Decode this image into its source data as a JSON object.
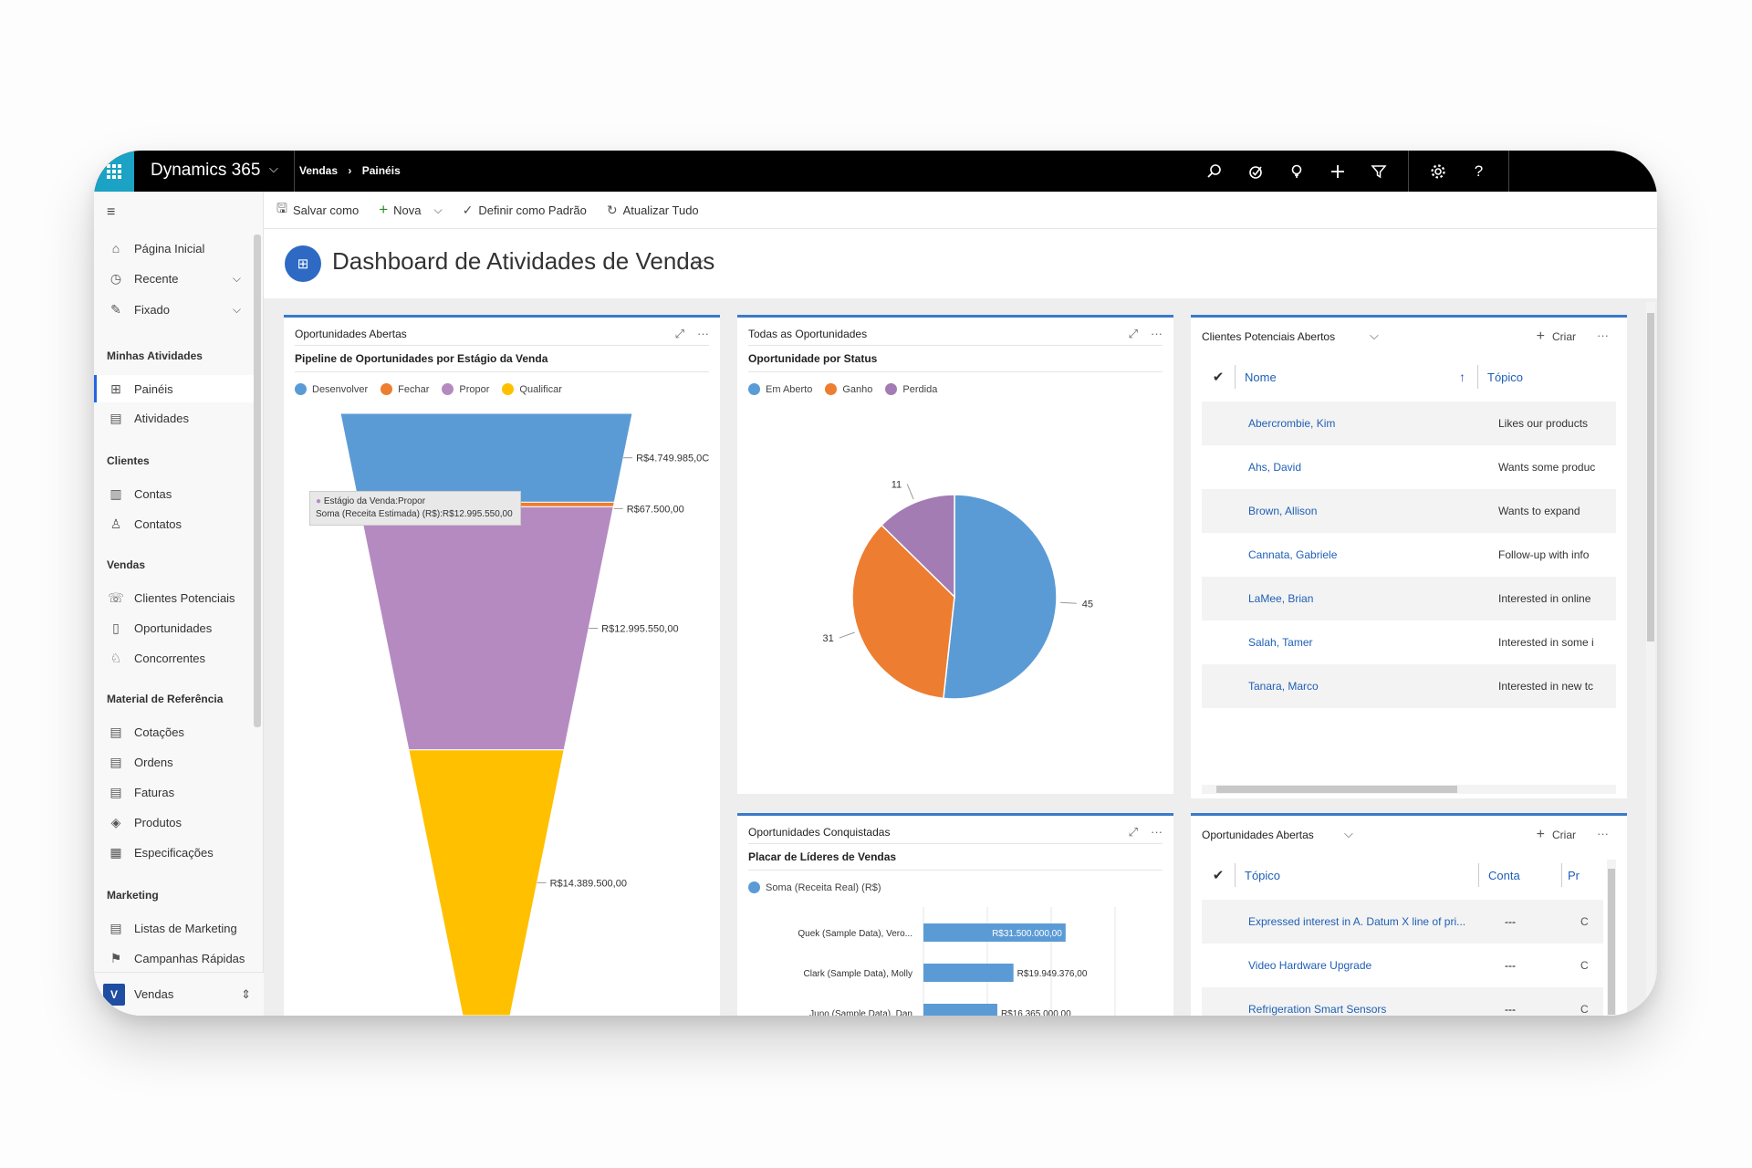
{
  "app": {
    "brand": "Dynamics 365",
    "breadcrumb": [
      "Vendas",
      "Painéis"
    ]
  },
  "commands": {
    "save_as": "Salvar como",
    "new": "Nova",
    "set_default": "Definir como Padrão",
    "refresh_all": "Atualizar Tudo"
  },
  "sidebar": {
    "top_items": [
      {
        "label": "Página Inicial",
        "icon": "home-icon"
      },
      {
        "label": "Recente",
        "icon": "clock-icon"
      },
      {
        "label": "Fixado",
        "icon": "pin-icon"
      }
    ],
    "groups": [
      {
        "heading": "Minhas Atividades",
        "items": [
          "Painéis",
          "Atividades"
        ]
      },
      {
        "heading": "Clientes",
        "items": [
          "Contas",
          "Contatos"
        ]
      },
      {
        "heading": "Vendas",
        "items": [
          "Clientes Potenciais",
          "Oportunidades",
          "Concorrentes"
        ]
      },
      {
        "heading": "Material de Referência",
        "items": [
          "Cotações",
          "Ordens",
          "Faturas",
          "Produtos",
          "Especificações"
        ]
      },
      {
        "heading": "Marketing",
        "items": [
          "Listas de Marketing",
          "Campanhas Rápidas"
        ]
      }
    ],
    "area": {
      "badge": "V",
      "label": "Vendas"
    }
  },
  "dashboard": {
    "title": "Dashboard de Atividades de Vendas"
  },
  "funnel_card": {
    "title": "Oportunidades Abertas",
    "subtitle": "Pipeline de Oportunidades por Estágio da Venda",
    "tooltip_line1": "Estágio da Venda:Propor",
    "tooltip_line2": "Soma (Receita Estimada) (R$):R$12.995.550,00"
  },
  "pie_card": {
    "title": "Todas as Oportunidades",
    "subtitle": "Oportunidade por Status"
  },
  "bar_card": {
    "title": "Oportunidades Conquistadas",
    "subtitle": "Placar de Líderes de Vendas"
  },
  "leads_card": {
    "title": "Clientes Potenciais Abertos",
    "create": "Criar",
    "columns": [
      "Nome",
      "Tópico"
    ],
    "rows": [
      {
        "name": "Abercrombie, Kim",
        "topic": "Likes our products"
      },
      {
        "name": "Ahs, David",
        "topic": "Wants some produc"
      },
      {
        "name": "Brown, Allison",
        "topic": "Wants to expand"
      },
      {
        "name": "Cannata, Gabriele",
        "topic": "Follow-up with info"
      },
      {
        "name": "LaMee, Brian",
        "topic": "Interested in online"
      },
      {
        "name": "Salah, Tamer",
        "topic": "Interested in some i"
      },
      {
        "name": "Tanara, Marco",
        "topic": "Interested in new tc"
      }
    ]
  },
  "opps_card": {
    "title": "Oportunidades Abertas",
    "create": "Criar",
    "columns": [
      "Tópico",
      "Conta",
      "Pr"
    ],
    "rows": [
      {
        "topic": "Expressed interest in A. Datum X line of pri...",
        "account": "---",
        "extra": "C"
      },
      {
        "topic": "Video Hardware Upgrade",
        "account": "---",
        "extra": "C"
      },
      {
        "topic": "Refrigeration Smart Sensors",
        "account": "---",
        "extra": "C"
      }
    ]
  },
  "chart_data": [
    {
      "type": "funnel",
      "title": "Pipeline de Oportunidades por Estágio da Venda",
      "series_name": "Soma (Receita Estimada) (R$)",
      "categories": [
        "Desenvolver",
        "Fechar",
        "Propor",
        "Qualificar"
      ],
      "colors": [
        "#5b9bd5",
        "#ed7d31",
        "#b58ac1",
        "#ffc000"
      ],
      "values": [
        4749985,
        67500,
        12995550,
        14389500
      ],
      "value_labels": [
        "R$4.749.985,0C",
        "R$67.500,00",
        "R$12.995.550,00",
        "R$14.389.500,00"
      ]
    },
    {
      "type": "pie",
      "title": "Oportunidade por Status",
      "categories": [
        "Em Aberto",
        "Ganho",
        "Perdida"
      ],
      "colors": [
        "#5b9bd5",
        "#ed7d31",
        "#a37cb3"
      ],
      "values": [
        45,
        31,
        11
      ]
    },
    {
      "type": "bar",
      "title": "Placar de Líderes de Vendas",
      "series_name": "Soma (Receita Real) (R$)",
      "color": "#5b9bd5",
      "categories": [
        "Quek (Sample Data), Vero...",
        "Clark (Sample Data), Molly",
        "Juno (Sample Data), Dan"
      ],
      "values": [
        31500000,
        19949376,
        16365000
      ],
      "value_labels": [
        "R$31.500.000,00",
        "R$19.949.376,00",
        "R$16.365.000,00"
      ]
    }
  ]
}
